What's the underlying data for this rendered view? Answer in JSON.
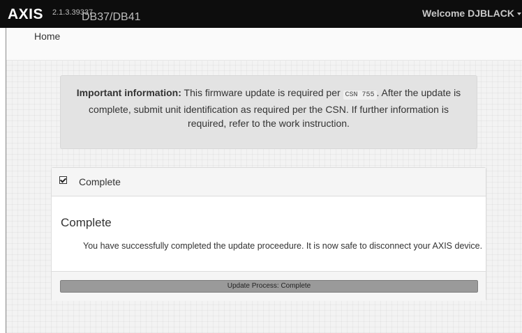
{
  "navbar": {
    "brand": "AXIS",
    "version": "2.1.3.39337",
    "model": "DB37/DB41",
    "welcome": "Welcome DJBLACK"
  },
  "breadcrumb": {
    "home": "Home"
  },
  "notice": {
    "label": "Important information:",
    "text_before": " This firmware update is required per ",
    "code": "CSN 755",
    "text_after": ". After the update is complete, submit unit identification as required per the CSN. If further information is required, refer to the work instruction."
  },
  "panel": {
    "heading": "Complete",
    "title": "Complete",
    "message": "You have successfully completed the update proceedure. It is now safe to disconnect your AXIS device.",
    "progress_label": "Update Process: Complete",
    "progress_percent": 100
  },
  "colors": {
    "navbar_bg": "#0d0d0d",
    "progress_fill": "#9a9a9a"
  }
}
